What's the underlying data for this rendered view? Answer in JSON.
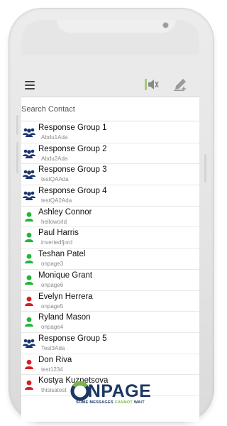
{
  "search": {
    "placeholder": "Search Contact"
  },
  "contacts": [
    {
      "name": "Response Group 1",
      "sub": "Abdu1Ada",
      "type": "group",
      "status_color": "#1b3570"
    },
    {
      "name": "Response Group 2",
      "sub": "Abdu2Ada",
      "type": "group",
      "status_color": "#1b3570"
    },
    {
      "name": "Response Group 3",
      "sub": "testQAAda",
      "type": "group",
      "status_color": "#1b3570"
    },
    {
      "name": "Response Group 4",
      "sub": "testQA2Ada",
      "type": "group",
      "status_color": "#1b3570"
    },
    {
      "name": "Ashley Connor",
      "sub": "helloworld",
      "type": "person",
      "status_color": "#22b53a"
    },
    {
      "name": "Paul Harris",
      "sub": "invertedfjord",
      "type": "person",
      "status_color": "#22b53a"
    },
    {
      "name": "Teshan Patel",
      "sub": "onpage3",
      "type": "person",
      "status_color": "#22b53a"
    },
    {
      "name": "Monique Grant",
      "sub": "onpage6",
      "type": "person",
      "status_color": "#22b53a"
    },
    {
      "name": "Evelyn Herrera",
      "sub": "onpage5",
      "type": "person",
      "status_color": "#d61f26"
    },
    {
      "name": "Ryland Mason",
      "sub": "onpage4",
      "type": "person",
      "status_color": "#22b53a"
    },
    {
      "name": "Response Group 5",
      "sub": "Test3Ada",
      "type": "group",
      "status_color": "#1b3570"
    },
    {
      "name": "Don Riva",
      "sub": "test1234",
      "type": "person",
      "status_color": "#d61f26"
    },
    {
      "name": "Kostya Kuznetsova",
      "sub": "thisisatest",
      "type": "person",
      "status_color": "#d61f26"
    }
  ],
  "brand": {
    "logo_text": "ONPAGE",
    "word": "NPAGE",
    "tag_prefix": "SOME MESSAGES ",
    "tag_highlight": "CANNOT",
    "tag_suffix": " WAIT"
  },
  "icons": {
    "menu": "hamburger-menu-icon",
    "mute": "speaker-mute-icon",
    "compose": "compose-pencil-icon",
    "group": "group-people-icon",
    "person": "person-icon"
  },
  "colors": {
    "brand_navy": "#1b3762",
    "brand_green": "#7ab648",
    "online": "#22b53a",
    "offline": "#d61f26",
    "group": "#1b3570"
  }
}
